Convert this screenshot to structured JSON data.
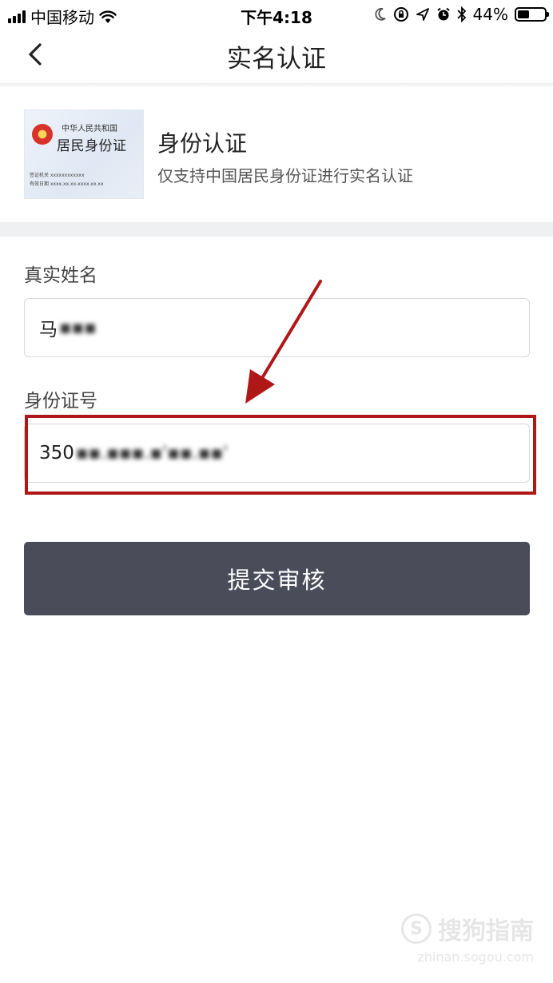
{
  "status_bar": {
    "carrier": "中国移动",
    "time": "下午4:18",
    "battery": "44%",
    "battery_level": 0.44,
    "icons": [
      "signal-icon",
      "wifi-icon",
      "moon-icon",
      "rotation-lock-icon",
      "location-icon",
      "alarm-icon",
      "bluetooth-icon",
      "battery-icon"
    ]
  },
  "nav": {
    "title": "实名认证",
    "back_icon": "chevron-left-icon"
  },
  "id_card": {
    "card_line1": "中华人民共和国",
    "card_line2": "居民身份证",
    "card_issuer": "签证机关  xxxxxxxxxxxx",
    "card_validity": "有效日期  xxxx.xx.xx-xxxx.xx.xx",
    "title": "身份认证",
    "description": "仅支持中国居民身份证进行实名认证"
  },
  "form": {
    "name_label": "真实姓名",
    "name_value": "马",
    "name_masked": "▪︎▪︎▪︎",
    "id_label": "身份证号",
    "id_value": "350",
    "id_masked": "▪︎▪︎.▪︎▪︎▪︎.▪︎'▪︎▪︎.▪︎▪︎'"
  },
  "submit_label": "提交审核",
  "annotation_color": "#b01818",
  "watermark": {
    "brand": "搜狗指南",
    "url": "zhinan.sogou.com"
  }
}
